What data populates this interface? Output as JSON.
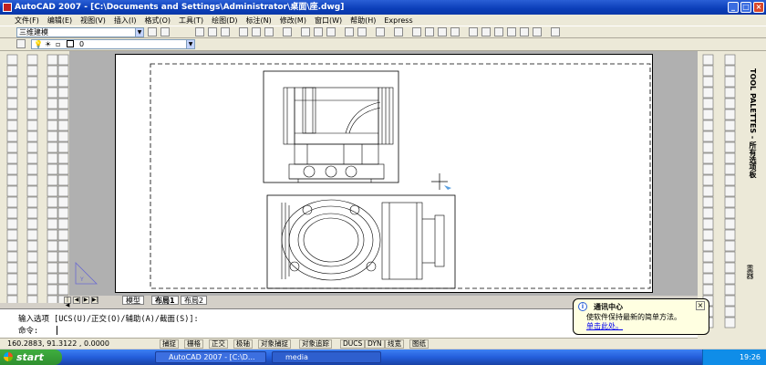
{
  "window": {
    "title": "AutoCAD 2007 - [C:\\Documents and Settings\\Administrator\\桌面\\座.dwg]"
  },
  "menu": [
    "文件(F)",
    "编辑(E)",
    "视图(V)",
    "插入(I)",
    "格式(O)",
    "工具(T)",
    "绘图(D)",
    "标注(N)",
    "修改(M)",
    "窗口(W)",
    "帮助(H)",
    "Express"
  ],
  "toolbar": {
    "workspace": "三维建模",
    "layer": "0"
  },
  "tool_palette": {
    "label": "TOOL PALETTES - 所有选项板",
    "section": "重器"
  },
  "layout_tabs": [
    "模型",
    "布局1",
    "布局2"
  ],
  "command": {
    "prompt1": "输入选项 [UCS(U)/正交(O)/辅助(A)/截面(S)]:",
    "prompt2": "命令:"
  },
  "status": {
    "coords": "160.2883,  91.3122  , 0.0000",
    "buttons": [
      "捕捉",
      "栅格",
      "正交",
      "极轴",
      "对象捕捉",
      "对象追踪",
      "DUCS",
      "DYN",
      "线宽",
      "图纸"
    ]
  },
  "balloon": {
    "title": "通讯中心",
    "body": "使软件保持最新的简单方法。",
    "link": "单击此处。"
  },
  "taskbar": {
    "start": "start",
    "tasks": [
      "AutoCAD 2007 - [C:\\D...",
      "media"
    ],
    "clock": "19:26"
  },
  "colors": {
    "title": "#0b3eb8",
    "taskbar": "#245edb",
    "start": "#2f8f2f"
  }
}
